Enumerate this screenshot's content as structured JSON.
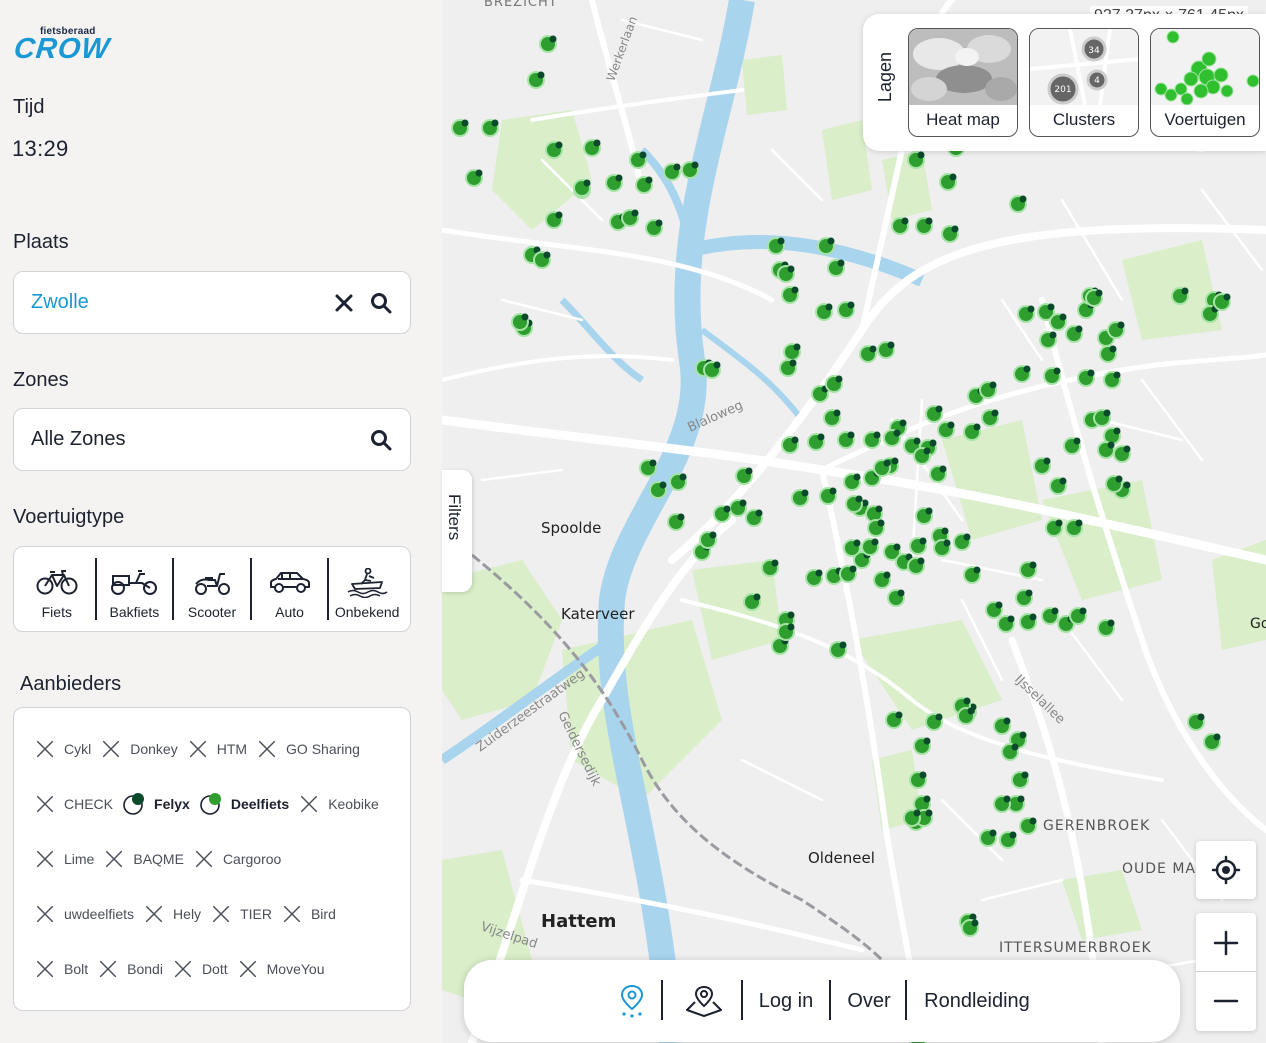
{
  "app": {
    "logo_small": "fietsberaad",
    "logo_big": "CROW"
  },
  "time": {
    "label": "Tijd",
    "value": "13:29"
  },
  "place": {
    "label": "Plaats",
    "value": "Zwolle"
  },
  "zones": {
    "label": "Zones",
    "value": "Alle Zones"
  },
  "vehicle_types": {
    "label": "Voertuigtype",
    "items": [
      {
        "label": "Fiets",
        "icon": "bicycle-icon"
      },
      {
        "label": "Bakfiets",
        "icon": "cargo-bike-icon"
      },
      {
        "label": "Scooter",
        "icon": "scooter-icon"
      },
      {
        "label": "Auto",
        "icon": "car-icon"
      },
      {
        "label": "Onbekend",
        "icon": "unknown-vehicle-icon"
      }
    ]
  },
  "providers": {
    "label": "Aanbieders",
    "rows": [
      [
        {
          "name": "Cykl",
          "active": false
        },
        {
          "name": "Donkey",
          "active": false
        },
        {
          "name": "HTM",
          "active": false
        },
        {
          "name": "GO Sharing",
          "active": false
        }
      ],
      [
        {
          "name": "CHECK",
          "active": false
        },
        {
          "name": "Felyx",
          "active": true,
          "color": "#0b4a2a"
        },
        {
          "name": "Deelfiets",
          "active": true,
          "color": "#2e9e2e"
        },
        {
          "name": "Keobike",
          "active": false
        }
      ],
      [
        {
          "name": "Lime",
          "active": false
        },
        {
          "name": "BAQME",
          "active": false
        },
        {
          "name": "Cargoroo",
          "active": false
        }
      ],
      [
        {
          "name": "uwdeelfiets",
          "active": false
        },
        {
          "name": "Hely",
          "active": false
        },
        {
          "name": "TIER",
          "active": false
        },
        {
          "name": "Bird",
          "active": false
        }
      ],
      [
        {
          "name": "Bolt",
          "active": false
        },
        {
          "name": "Bondi",
          "active": false
        },
        {
          "name": "Dott",
          "active": false
        },
        {
          "name": "MoveYou",
          "active": false
        }
      ]
    ]
  },
  "filters_tab": "Filters",
  "dimension_readout": "927.27px × 761.45px",
  "layers": {
    "label": "Lagen",
    "items": [
      {
        "label": "Heat map"
      },
      {
        "label": "Clusters"
      },
      {
        "label": "Voertuigen"
      }
    ],
    "cluster_counts": [
      "34",
      "201",
      "4"
    ]
  },
  "map_labels": {
    "spoolde": "Spoolde",
    "katerveer": "Katerveer",
    "oldeneel": "Oldeneel",
    "hattem": "Hattem",
    "gerenbroek": "GERENBROEK",
    "oude_mars": "OUDE MA",
    "ittersumerbroek": "ITTERSUMERBROEK",
    "blaloweg": "Blaloweg",
    "ijsselallee": "IJsselallee",
    "zuiderzeestraatweg": "Zuiderzeestraatweg",
    "geldersedijk": "Geldersedijk",
    "vijzelpad": "Vijzelpad",
    "werkerlaan": "Werkerlaan",
    "brezicht": "BREZICHT",
    "go": "Go"
  },
  "bottom_bar": {
    "login": "Log in",
    "about": "Over",
    "tour": "Rondleiding"
  },
  "colors": {
    "accent": "#1a98d5",
    "vehicle_fill": "#2e9e2e",
    "vehicle_dark": "#0b4a2a"
  }
}
